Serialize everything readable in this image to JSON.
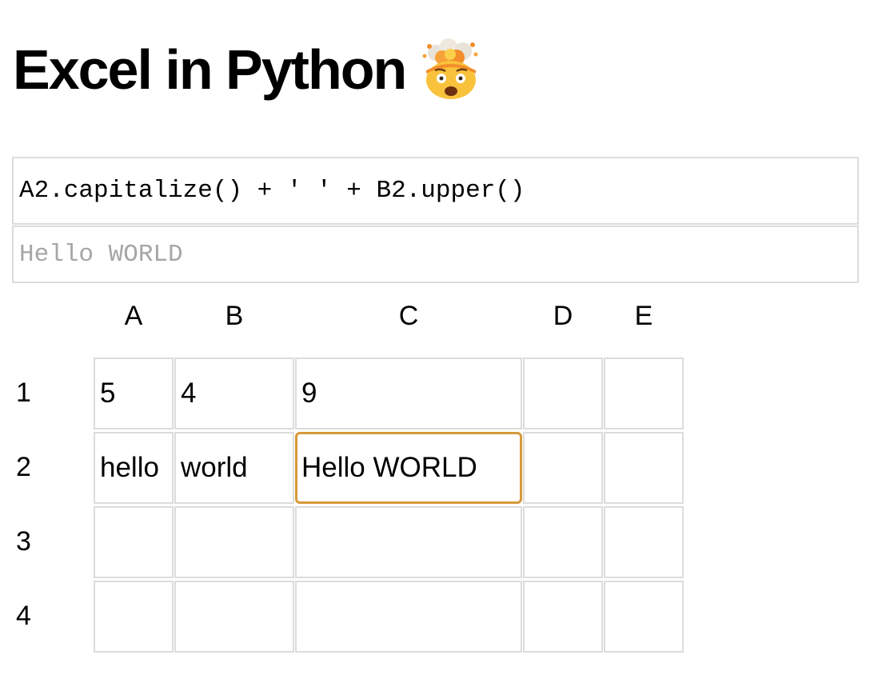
{
  "title": "Excel in Python",
  "title_emoji": "exploding-head-emoji",
  "formula": {
    "input": "A2.capitalize() + ' ' + B2.upper()",
    "output": "Hello WORLD"
  },
  "columns": [
    "A",
    "B",
    "C",
    "D",
    "E"
  ],
  "rows": [
    "1",
    "2",
    "3",
    "4"
  ],
  "cells": [
    [
      "5",
      "4",
      "9",
      "",
      ""
    ],
    [
      "hello",
      "world",
      "Hello WORLD",
      "",
      ""
    ],
    [
      "",
      "",
      "",
      "",
      ""
    ],
    [
      "",
      "",
      "",
      "",
      ""
    ]
  ],
  "selected_cell": "C2",
  "colors": {
    "accent": "#d7993b",
    "grid": "#dcdcdc",
    "muted_text": "#a6a6a6"
  }
}
